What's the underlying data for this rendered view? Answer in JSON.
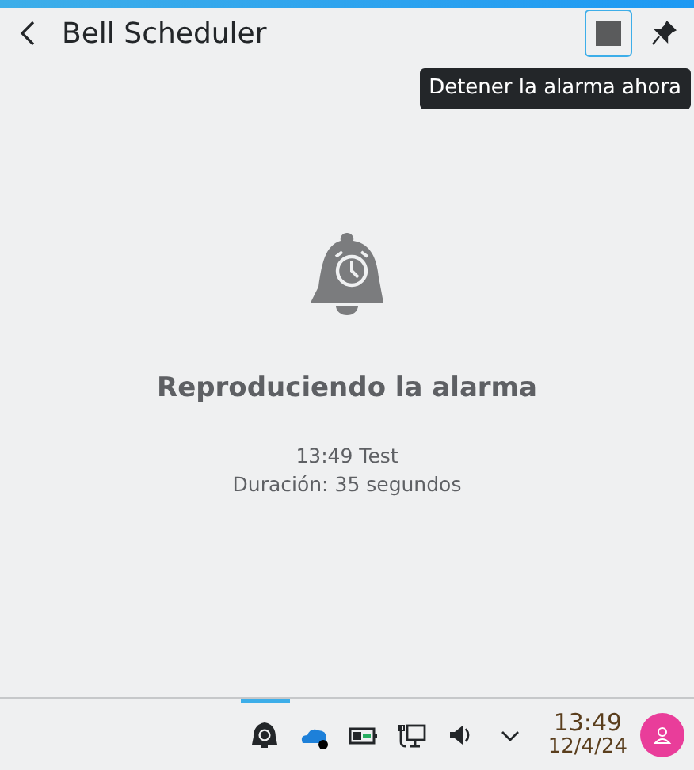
{
  "header": {
    "title": "Bell Scheduler"
  },
  "tooltip": {
    "text": "Detener la alarma ahora"
  },
  "status": {
    "title": "Reproduciendo la alarma",
    "lines": [
      "13:49 Test",
      "Duración: 35 segundos"
    ]
  },
  "taskbar": {
    "time": "13:49",
    "date": "12/4/24",
    "tray": [
      {
        "kind": "bell",
        "active": true
      },
      {
        "kind": "cloud",
        "active": false
      },
      {
        "kind": "battery",
        "active": false
      },
      {
        "kind": "network",
        "active": false
      },
      {
        "kind": "volume",
        "active": false
      },
      {
        "kind": "expand",
        "active": false
      }
    ]
  }
}
